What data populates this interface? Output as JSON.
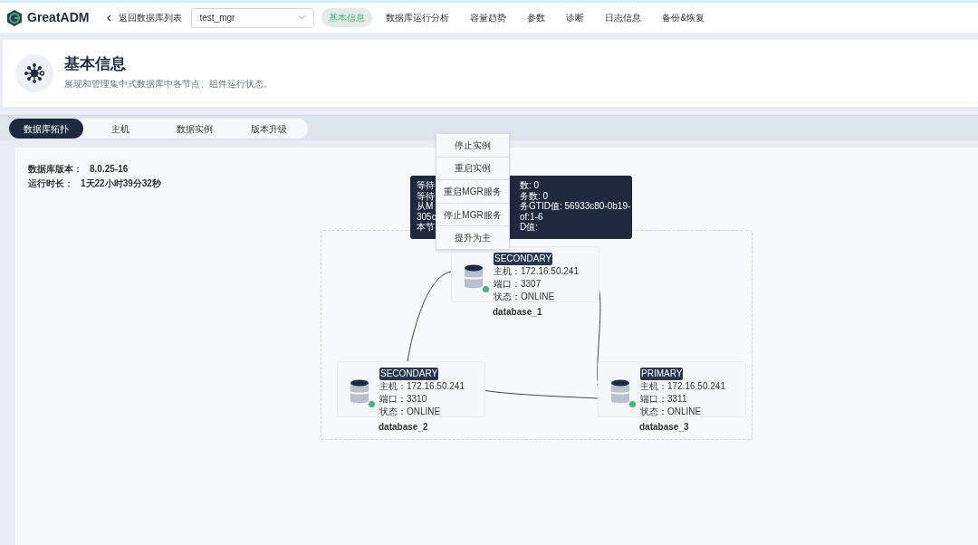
{
  "app": {
    "name": "GreatADM"
  },
  "topbar": {
    "back_link": "返回数据库列表",
    "database_select": {
      "value": "test_mgr"
    },
    "nav": [
      {
        "label": "基本信息",
        "selected": true
      },
      {
        "label": "数据库运行分析",
        "selected": false
      },
      {
        "label": "容量趋势",
        "selected": false
      },
      {
        "label": "参数",
        "selected": false
      },
      {
        "label": "诊断",
        "selected": false
      },
      {
        "label": "日志信息",
        "selected": false
      },
      {
        "label": "备份&恢复",
        "selected": false
      }
    ]
  },
  "header": {
    "title": "基本信息",
    "subtitle": "展现和管理集中式数据库中各节点、组件运行状态。"
  },
  "tabs": [
    {
      "label": "数据库拓扑",
      "selected": true
    },
    {
      "label": "主机",
      "selected": false
    },
    {
      "label": "数据实例",
      "selected": false
    },
    {
      "label": "版本升级",
      "selected": false
    }
  ],
  "info": [
    {
      "label": "数据库版本：",
      "value": "8.0.25-16"
    },
    {
      "label": "运行时长：",
      "value": "1天22小时39分32秒"
    }
  ],
  "nodes": [
    {
      "role": "SECONDARY",
      "host_label": "主机：",
      "host": "172.16.50.241",
      "port_label": "端口：",
      "port": "3307",
      "status_label": "状态：",
      "status": "ONLINE",
      "name": "database_1",
      "color": "#3cb878"
    },
    {
      "role": "SECONDARY",
      "host_label": "主机：",
      "host": "172.16.50.241",
      "port_label": "端口：",
      "port": "3310",
      "status_label": "状态：",
      "status": "ONLINE",
      "name": "database_2",
      "color": "#3cb878"
    },
    {
      "role": "PRIMARY",
      "host_label": "主机：",
      "host": "172.16.50.241",
      "port_label": "端口：",
      "port": "3311",
      "status_label": "状态：",
      "status": "ONLINE",
      "name": "database_3",
      "color": "#3cb878"
    }
  ],
  "tooltip": {
    "lines": [
      {
        "left": "等待",
        "right": "数: 0"
      },
      {
        "left": "等待",
        "right": "务数: 0"
      },
      {
        "left": "从M",
        "right": "务GTID值: 56933c80-0b19-"
      },
      {
        "left": "305c",
        "right": "of:1-6"
      },
      {
        "left": "本节",
        "right": "D值:"
      }
    ]
  },
  "context_menu": {
    "items": [
      "停止实例",
      "重启实例",
      "重启MGR服务",
      "停止MGR服务",
      "提升为主"
    ]
  }
}
